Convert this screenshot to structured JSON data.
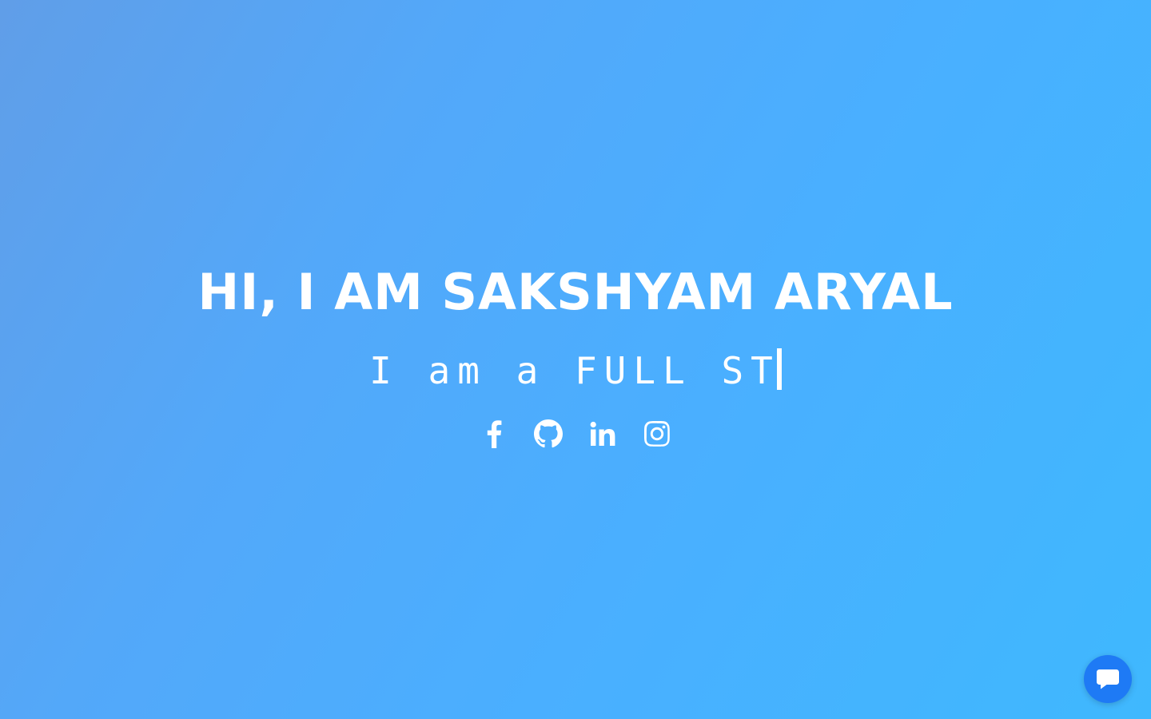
{
  "hero": {
    "title": "HI, I AM SAKSHYAM ARYAL",
    "typing_text": "I am a FULL ST"
  },
  "social": [
    {
      "name": "facebook",
      "icon": "facebook-icon"
    },
    {
      "name": "github",
      "icon": "github-icon"
    },
    {
      "name": "linkedin",
      "icon": "linkedin-icon"
    },
    {
      "name": "instagram",
      "icon": "instagram-icon"
    }
  ],
  "chat": {
    "icon": "chat-bubble-icon"
  },
  "colors": {
    "gradient_start": "#609ee8",
    "gradient_end": "#3fb8fe",
    "text": "#ffffff",
    "chat_button": "#1e7af5"
  }
}
